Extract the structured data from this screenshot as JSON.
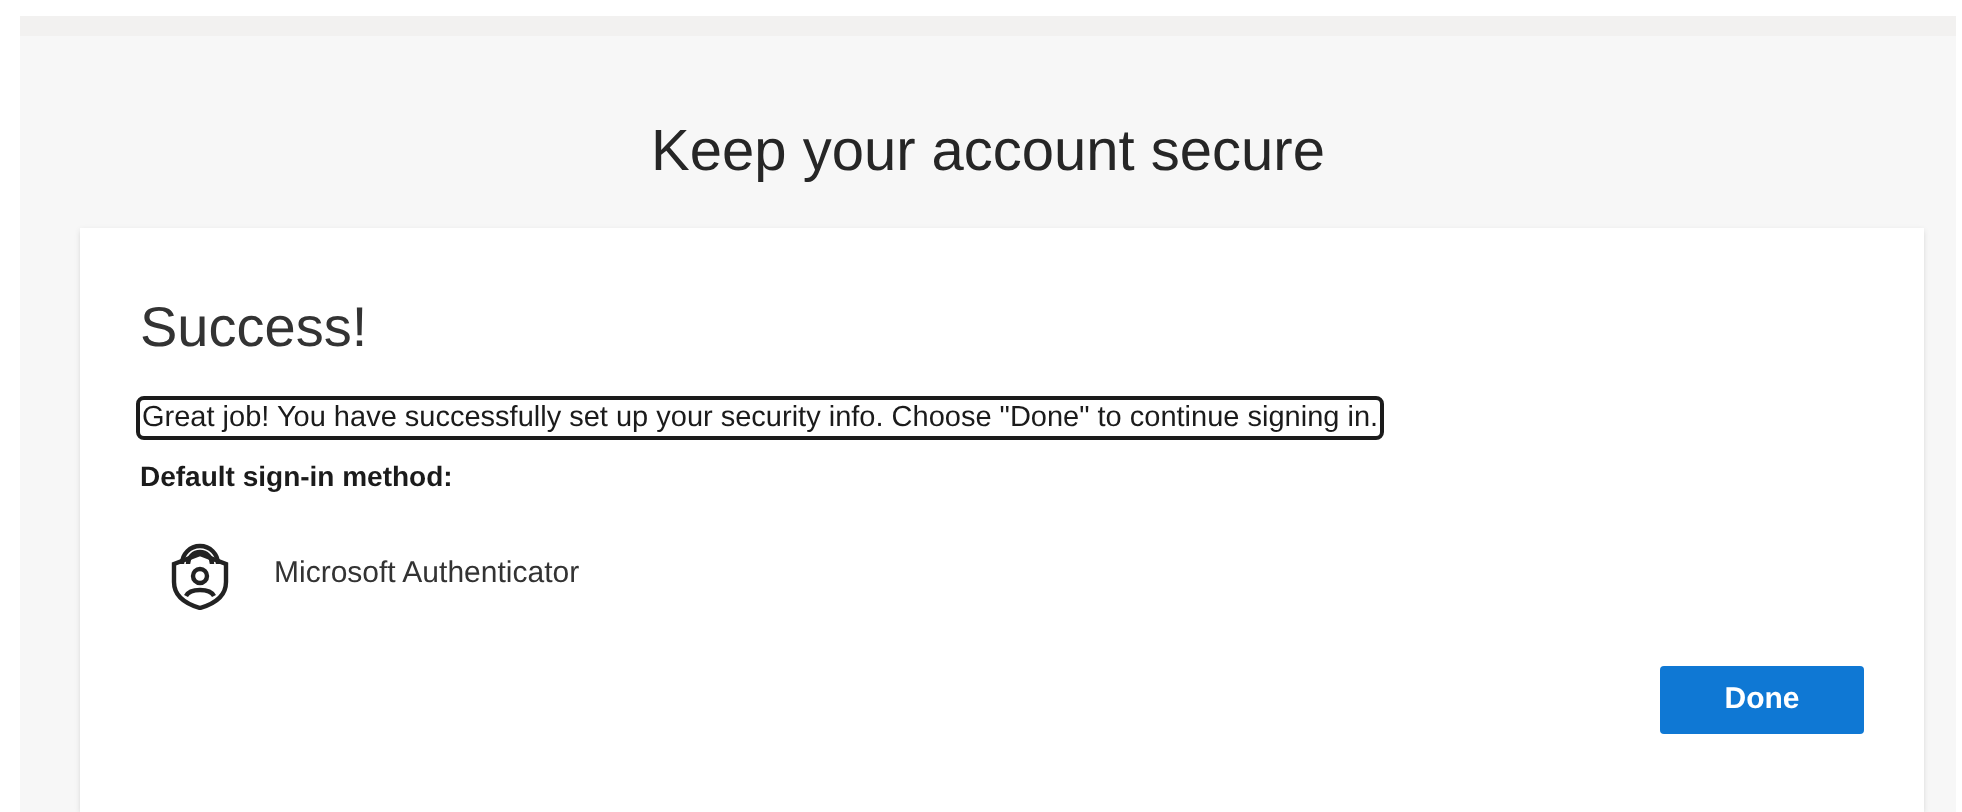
{
  "page": {
    "title": "Keep your account secure"
  },
  "card": {
    "heading": "Success!",
    "message": {
      "text": "Great job! You have successfully set up your security info. Choose \"Done\" to continue signing in.",
      "focused": true
    },
    "method_label": "Default sign-in method:",
    "method": {
      "name": "Microsoft Authenticator"
    },
    "button": "Done"
  }
}
